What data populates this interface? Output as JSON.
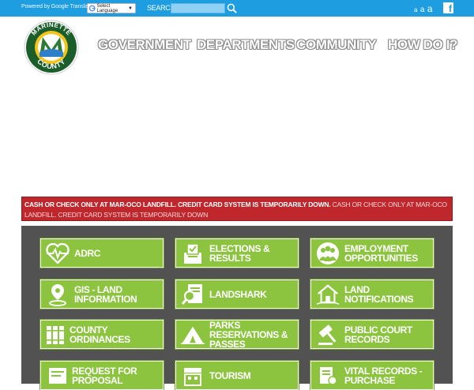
{
  "topbar": {
    "powered_by": "Powered by Google Translate",
    "language_select": "Select Language",
    "search_label": "SEARCH",
    "search_value": "",
    "fontsize": [
      "a",
      "a",
      "a"
    ],
    "facebook_letter": "f"
  },
  "logo": {
    "top_text": "MARINETTE",
    "bottom_text": "COUNTY",
    "letter": "M"
  },
  "nav": [
    "GOVERNMENT",
    "DEPARTMENTS",
    "COMMUNITY",
    "HOW DO I?"
  ],
  "alert": {
    "bold": "CASH OR CHECK ONLY AT MAR-OCO LANDFILL. CREDIT CARD SYSTEM IS TEMPORARILY DOWN.",
    "normal": " CASH OR CHECK ONLY AT MAR-OCO LANDFILL. CREDIT CARD SYSTEM IS TEMPORARILY DOWN"
  },
  "tiles": [
    {
      "label": "ADRC",
      "icon": "heart-pulse-icon"
    },
    {
      "label": "ELECTIONS & RESULTS",
      "icon": "ballot-box-icon"
    },
    {
      "label": "EMPLOYMENT OPPORTUNITIES",
      "icon": "people-group-icon"
    },
    {
      "label": "GIS - LAND INFORMATION",
      "icon": "map-pin-icon"
    },
    {
      "label": "LANDSHARK",
      "icon": "document-search-icon"
    },
    {
      "label": "LAND NOTIFICATIONS",
      "icon": "house-icon"
    },
    {
      "label": "COUNTY ORDINANCES",
      "icon": "books-icon"
    },
    {
      "label": "PARKS RESERVATIONS & PASSES",
      "icon": "tent-icon"
    },
    {
      "label": "PUBLIC COURT RECORDS",
      "icon": "gavel-icon"
    },
    {
      "label": "REQUEST FOR PROPOSAL",
      "icon": "ticket-icon"
    },
    {
      "label": "TOURISM",
      "icon": "storefront-icon"
    },
    {
      "label": "VITAL RECORDS - PURCHASE",
      "icon": "certificate-icon"
    }
  ],
  "colors": {
    "topbar": "#1e9ee0",
    "tile": "#8cc43f",
    "panel": "#525252",
    "alert": "#c0272d"
  }
}
